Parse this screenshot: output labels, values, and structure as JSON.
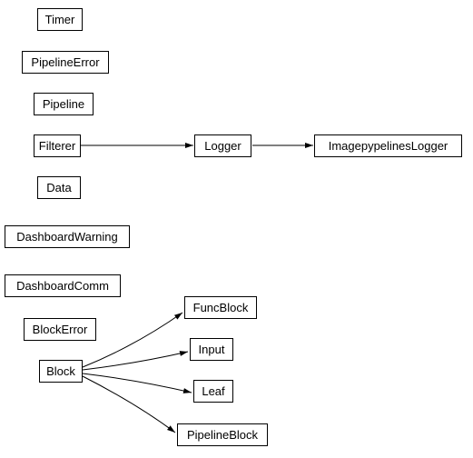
{
  "nodes": {
    "timer": "Timer",
    "pipelineError": "PipelineError",
    "pipeline": "Pipeline",
    "filterer": "Filterer",
    "logger": "Logger",
    "imagepypelinesLogger": "ImagepypelinesLogger",
    "data": "Data",
    "dashboardWarning": "DashboardWarning",
    "dashboardComm": "DashboardComm",
    "blockError": "BlockError",
    "funcBlock": "FuncBlock",
    "block": "Block",
    "input": "Input",
    "leaf": "Leaf",
    "pipelineBlock": "PipelineBlock"
  }
}
